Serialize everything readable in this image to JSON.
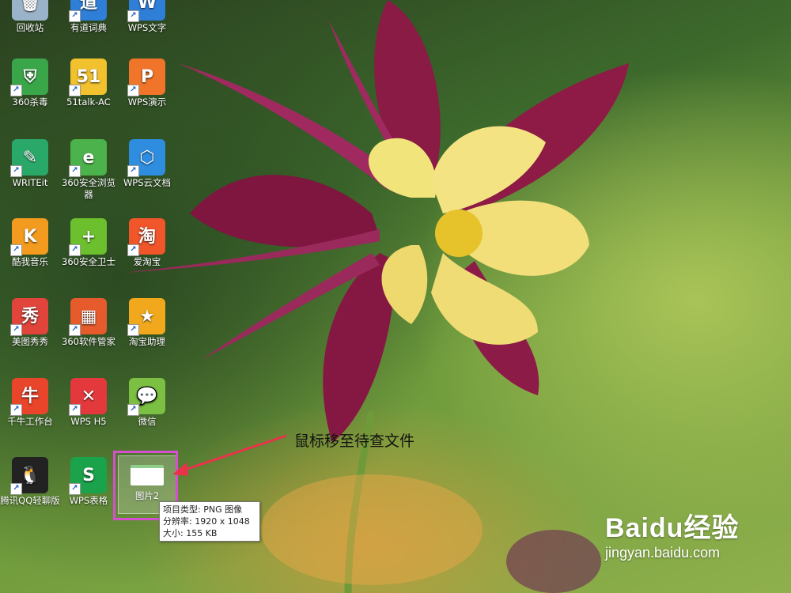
{
  "desktop_icons": [
    {
      "label": "回收站",
      "icon": "recycle-bin-icon",
      "color": "#9bb3c9",
      "glyph": "🗑",
      "shortcut": false
    },
    {
      "label": "有道词典",
      "icon": "youdao-dictionary-icon",
      "color": "#2f7fd8",
      "glyph": "道",
      "shortcut": true
    },
    {
      "label": "WPS文字",
      "icon": "wps-writer-icon",
      "color": "#2f7fd8",
      "glyph": "W",
      "shortcut": true
    },
    {
      "label": "360杀毒",
      "icon": "360-antivirus-icon",
      "color": "#3aa64a",
      "glyph": "⛨",
      "shortcut": true
    },
    {
      "label": "51talk-AC",
      "icon": "51talk-icon",
      "color": "#f2c12e",
      "glyph": "51",
      "shortcut": true
    },
    {
      "label": "WPS演示",
      "icon": "wps-presentation-icon",
      "color": "#f0752a",
      "glyph": "P",
      "shortcut": true
    },
    {
      "label": "WRITEit",
      "icon": "writeit-icon",
      "color": "#2aa86a",
      "glyph": "✎",
      "shortcut": true
    },
    {
      "label": "360安全浏览器",
      "icon": "360-browser-icon",
      "color": "#4cb24b",
      "glyph": "e",
      "shortcut": true
    },
    {
      "label": "WPS云文档",
      "icon": "wps-cloud-docs-icon",
      "color": "#2f8de0",
      "glyph": "⬡",
      "shortcut": true
    },
    {
      "label": "酷我音乐",
      "icon": "kuwo-music-icon",
      "color": "#f39b1e",
      "glyph": "K",
      "shortcut": true
    },
    {
      "label": "360安全卫士",
      "icon": "360-safe-guard-icon",
      "color": "#6cc02e",
      "glyph": "+",
      "shortcut": true
    },
    {
      "label": "爱淘宝",
      "icon": "ai-taobao-icon",
      "color": "#f0562a",
      "glyph": "淘",
      "shortcut": true
    },
    {
      "label": "美图秀秀",
      "icon": "meitu-xiuxiu-icon",
      "color": "#e0443a",
      "glyph": "秀",
      "shortcut": true
    },
    {
      "label": "360软件管家",
      "icon": "360-software-manager-icon",
      "color": "#e65b2b",
      "glyph": "▦",
      "shortcut": true
    },
    {
      "label": "淘宝助理",
      "icon": "taobao-assistant-icon",
      "color": "#f1a81c",
      "glyph": "★",
      "shortcut": true
    },
    {
      "label": "千牛工作台",
      "icon": "qianniu-icon",
      "color": "#e8452b",
      "glyph": "牛",
      "shortcut": true
    },
    {
      "label": "WPS H5",
      "icon": "wps-h5-icon",
      "color": "#e4393c",
      "glyph": "✕",
      "shortcut": true
    },
    {
      "label": "微信",
      "icon": "wechat-icon",
      "color": "#7bc043",
      "glyph": "💬",
      "shortcut": true
    },
    {
      "label": "腾讯QQ轻聊版",
      "icon": "qq-lite-icon",
      "color": "#222222",
      "glyph": "🐧",
      "shortcut": true
    },
    {
      "label": "WPS表格",
      "icon": "wps-spreadsheet-icon",
      "color": "#1aa34a",
      "glyph": "S",
      "shortcut": true
    },
    {
      "label": "图片2",
      "icon": "image-file-icon",
      "color": "#dfe8d8",
      "glyph": "",
      "shortcut": false
    }
  ],
  "tooltip": {
    "type_line": "项目类型: PNG 图像",
    "resolution_line": "分辨率: 1920 x 1048",
    "size_line": "大小: 155 KB"
  },
  "annotation": {
    "text": "鼠标移至待查文件"
  },
  "watermark": {
    "logo_text": "Baidu经验",
    "url": "jingyan.baidu.com"
  },
  "colors": {
    "selection_border": "#d64fd0",
    "arrow": "#e8334a"
  }
}
